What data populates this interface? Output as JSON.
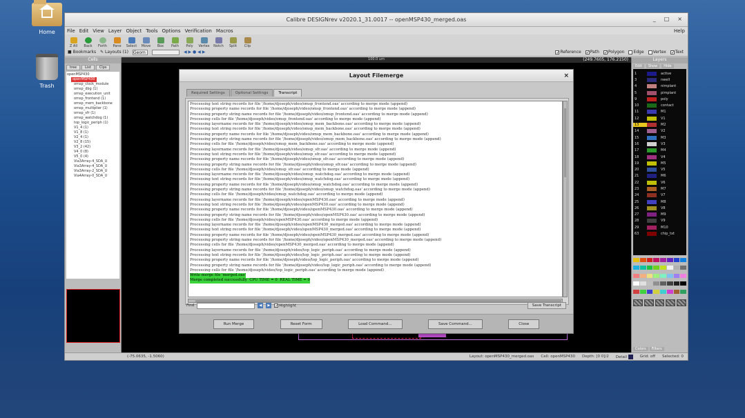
{
  "desktop": {
    "icons": [
      {
        "label": "Home"
      },
      {
        "label": "Trash"
      }
    ]
  },
  "window": {
    "title": "Calibre DESIGNrev v2020.1_31.0017 -- openMSP430_merged.oas",
    "controls": [
      "_",
      "□",
      "×"
    ],
    "menu": [
      "File",
      "Edit",
      "View",
      "Layer",
      "Object",
      "Tools",
      "Options",
      "Verification",
      "Macros"
    ],
    "help": "Help",
    "toolbar1": [
      "Z All",
      "Back",
      "Forth",
      "Pane",
      "Select",
      "Move",
      "Box",
      "Path",
      "Poly",
      "Vertex",
      "Notch",
      "Split",
      "Clip"
    ],
    "toolbar2": {
      "bookmarks": "Bookmarks",
      "layouts": "Layouts (1)",
      "geom": "Geom",
      "checks": [
        "Reference",
        "Path",
        "Polygon",
        "Edge",
        "Vertex",
        "Text"
      ]
    },
    "coordinates": "(249.7605, 176.2150)",
    "ruler_label": "100.0 um"
  },
  "cells_panel": {
    "title": "Cells",
    "tabs": [
      "tree",
      "List",
      "Clps"
    ],
    "root": "openMSP430",
    "selected": "openMSP430",
    "items": [
      "omsp_clock_module",
      "omsp_dbg (1)",
      "omsp_execution_unit",
      "omsp_frontend (1)",
      "omsp_mem_backbone",
      "omsp_multiplier (1)",
      "omsp_sfr (1)",
      "omsp_watchdog (1)",
      "top_logic_periph (1)",
      "V1_4 (1)",
      "V1_8 (1)",
      "V2_4 (1)",
      "V2_8 (15)",
      "V3_2 (42)",
      "V4_0 (8)",
      "V5_0 (4)",
      "Via3Array-4_SDA_U",
      "Via3Array-4_SDA_U",
      "Via3Array-2_SDA_U",
      "Via4Array-0_SDA_U"
    ]
  },
  "layers_panel": {
    "title": "Layers",
    "header": [
      "Edit",
      "Show",
      "Hide"
    ],
    "layers": [
      {
        "num": "1",
        "name": "active",
        "color": "#1a1a8a"
      },
      {
        "num": "3",
        "name": "nwell",
        "color": "#2a2a7a"
      },
      {
        "num": "4",
        "name": "nimplant",
        "color": "#c08080"
      },
      {
        "num": "5",
        "name": "pimplant",
        "color": "#a0506a"
      },
      {
        "num": "9",
        "name": "poly",
        "color": "#c02020"
      },
      {
        "num": "10",
        "name": "contact",
        "color": "#1a6a1a"
      },
      {
        "num": "11",
        "name": "M1",
        "color": "#3a3ab0"
      },
      {
        "num": "12",
        "name": "V1",
        "color": "#c0c000"
      },
      {
        "num": "13",
        "name": "M2",
        "color": "#b03030",
        "highlight": true
      },
      {
        "num": "14",
        "name": "V2",
        "color": "#a06090"
      },
      {
        "num": "15",
        "name": "M3",
        "color": "#3070c0"
      },
      {
        "num": "16",
        "name": "V3",
        "color": "#d0d0d0"
      },
      {
        "num": "17",
        "name": "M4",
        "color": "#2a9a2a"
      },
      {
        "num": "18",
        "name": "V4",
        "color": "#a03080"
      },
      {
        "num": "19",
        "name": "M5",
        "color": "#c0c000"
      },
      {
        "num": "20",
        "name": "V5",
        "color": "#3050a0"
      },
      {
        "num": "21",
        "name": "M6",
        "color": "#202080"
      },
      {
        "num": "22",
        "name": "V6",
        "color": "#c0c000"
      },
      {
        "num": "23",
        "name": "M7",
        "color": "#b06020"
      },
      {
        "num": "24",
        "name": "V7",
        "color": "#903020"
      },
      {
        "num": "25",
        "name": "M8",
        "color": "#4040c0"
      },
      {
        "num": "26",
        "name": "V8",
        "color": "#a09020"
      },
      {
        "num": "27",
        "name": "M9",
        "color": "#802080"
      },
      {
        "num": "28",
        "name": "V9",
        "color": "#404040"
      },
      {
        "num": "29",
        "name": "M10",
        "color": "#a02060"
      },
      {
        "num": "63",
        "name": "chip_txt",
        "color": "#800000"
      }
    ],
    "bottom_tabs": [
      "Colors",
      "Filters"
    ]
  },
  "statusbar": {
    "coord": "(-75.0635, -1.5060)",
    "layout": "Layout: openMSP430_merged.oas",
    "cell": "Cell: openMSP430",
    "depth": "Depth: [0 0]/2",
    "detail": "Detail",
    "grid": "Grid: off",
    "selected": "Selected: 0"
  },
  "dialog": {
    "title": "Layout Filemerge",
    "close": "×",
    "tabs": [
      "Required Settings",
      "Optional Settings",
      "Transcript"
    ],
    "active_tab": "Transcript",
    "transcript_lines": [
      "Processing text string records for file '/home/djoseph/video/omsp_frontend.oas' according to merge mode (append)",
      "Processing property name records for file '/home/djoseph/video/omsp_frontend.oas' according to merge mode (append)",
      "Processing property string name records for file '/home/djoseph/video/omsp_frontend.oas' according to merge mode (append)",
      "Processing cells for file '/home/djoseph/video/omsp_frontend.oas' according to merge mode (append)",
      "Processing layername records for file '/home/djoseph/video/omsp_mem_backbone.oas' according to merge mode (append)",
      "Processing text string records for file '/home/djoseph/video/omsp_mem_backbone.oas' according to merge mode (append)",
      "Processing property name records for file '/home/djoseph/video/omsp_mem_backbone.oas' according to merge mode (append)",
      "Processing property string name records for file '/home/djoseph/video/omsp_mem_backbone.oas' according to merge mode (append)",
      "Processing cells for file '/home/djoseph/video/omsp_mem_backbone.oas' according to merge mode (append)",
      "Processing layername records for file '/home/djoseph/video/omsp_sfr.oas' according to merge mode (append)",
      "Processing text string records for file '/home/djoseph/video/omsp_sfr.oas' according to merge mode (append)",
      "Processing property name records for file '/home/djoseph/video/omsp_sfr.oas' according to merge mode (append)",
      "Processing property string name records for file '/home/djoseph/video/omsp_sfr.oas' according to merge mode (append)",
      "Processing cells for file '/home/djoseph/video/omsp_sfr.oas' according to merge mode (append)",
      "Processing layername records for file '/home/djoseph/video/omsp_watchdog.oas' according to merge mode (append)",
      "Processing text string records for file '/home/djoseph/video/omsp_watchdog.oas' according to merge mode (append)",
      "Processing property name records for file '/home/djoseph/video/omsp_watchdog.oas' according to merge mode (append)",
      "Processing property string name records for file '/home/djoseph/video/omsp_watchdog.oas' according to merge mode (append)",
      "Processing cells for file '/home/djoseph/video/omsp_watchdog.oas' according to merge mode (append)",
      "Processing layername records for file '/home/djoseph/video/openMSP430.oas' according to merge mode (append)",
      "Processing text string records for file '/home/djoseph/video/openMSP430.oas' according to merge mode (append)",
      "Processing property name records for file '/home/djoseph/video/openMSP430.oas' according to merge mode (append)",
      "Processing property string name records for file '/home/djoseph/video/openMSP430.oas' according to merge mode (append)",
      "Processing cells for file '/home/djoseph/video/openMSP430.oas' according to merge mode (append)",
      "Processing layername records for file '/home/djoseph/video/openMSP430_merged.oas' according to merge mode (append)",
      "Processing text string records for file '/home/djoseph/video/openMSP430_merged.oas' according to merge mode (append)",
      "Processing property name records for file '/home/djoseph/video/openMSP430_merged.oas' according to merge mode (append)",
      "Processing property string name records for file '/home/djoseph/video/openMSP430_merged.oas' according to merge mode (append)",
      "Processing cells for file '/home/djoseph/video/openMSP430_merged.oas' according to merge mode (append)",
      "Processing layername records for file '/home/djoseph/video/top_logic_periph.oas' according to merge mode (append)",
      "Processing text string records for file '/home/djoseph/video/top_logic_periph.oas' according to merge mode (append)",
      "Processing property name records for file '/home/djoseph/video/top_logic_periph.oas' according to merge mode (append)",
      "Processing property string name records for file '/home/djoseph/video/top_logic_periph.oas' according to merge mode (append)",
      "Processing cells for file '/home/djoseph/video/top_logic_periph.oas' according to merge mode (append)"
    ],
    "status_lines": [
      "Write merge file 'merged.oas'",
      "Merge completed successfully  CPU TIME = 0  REAL TIME = 0"
    ],
    "find_label": "Find",
    "highlight_label": "Highlight",
    "save_transcript": "Save Transcript",
    "buttons": [
      "Run Merge",
      "Reset Form",
      "Load Command...",
      "Save Command...",
      "Close"
    ]
  }
}
